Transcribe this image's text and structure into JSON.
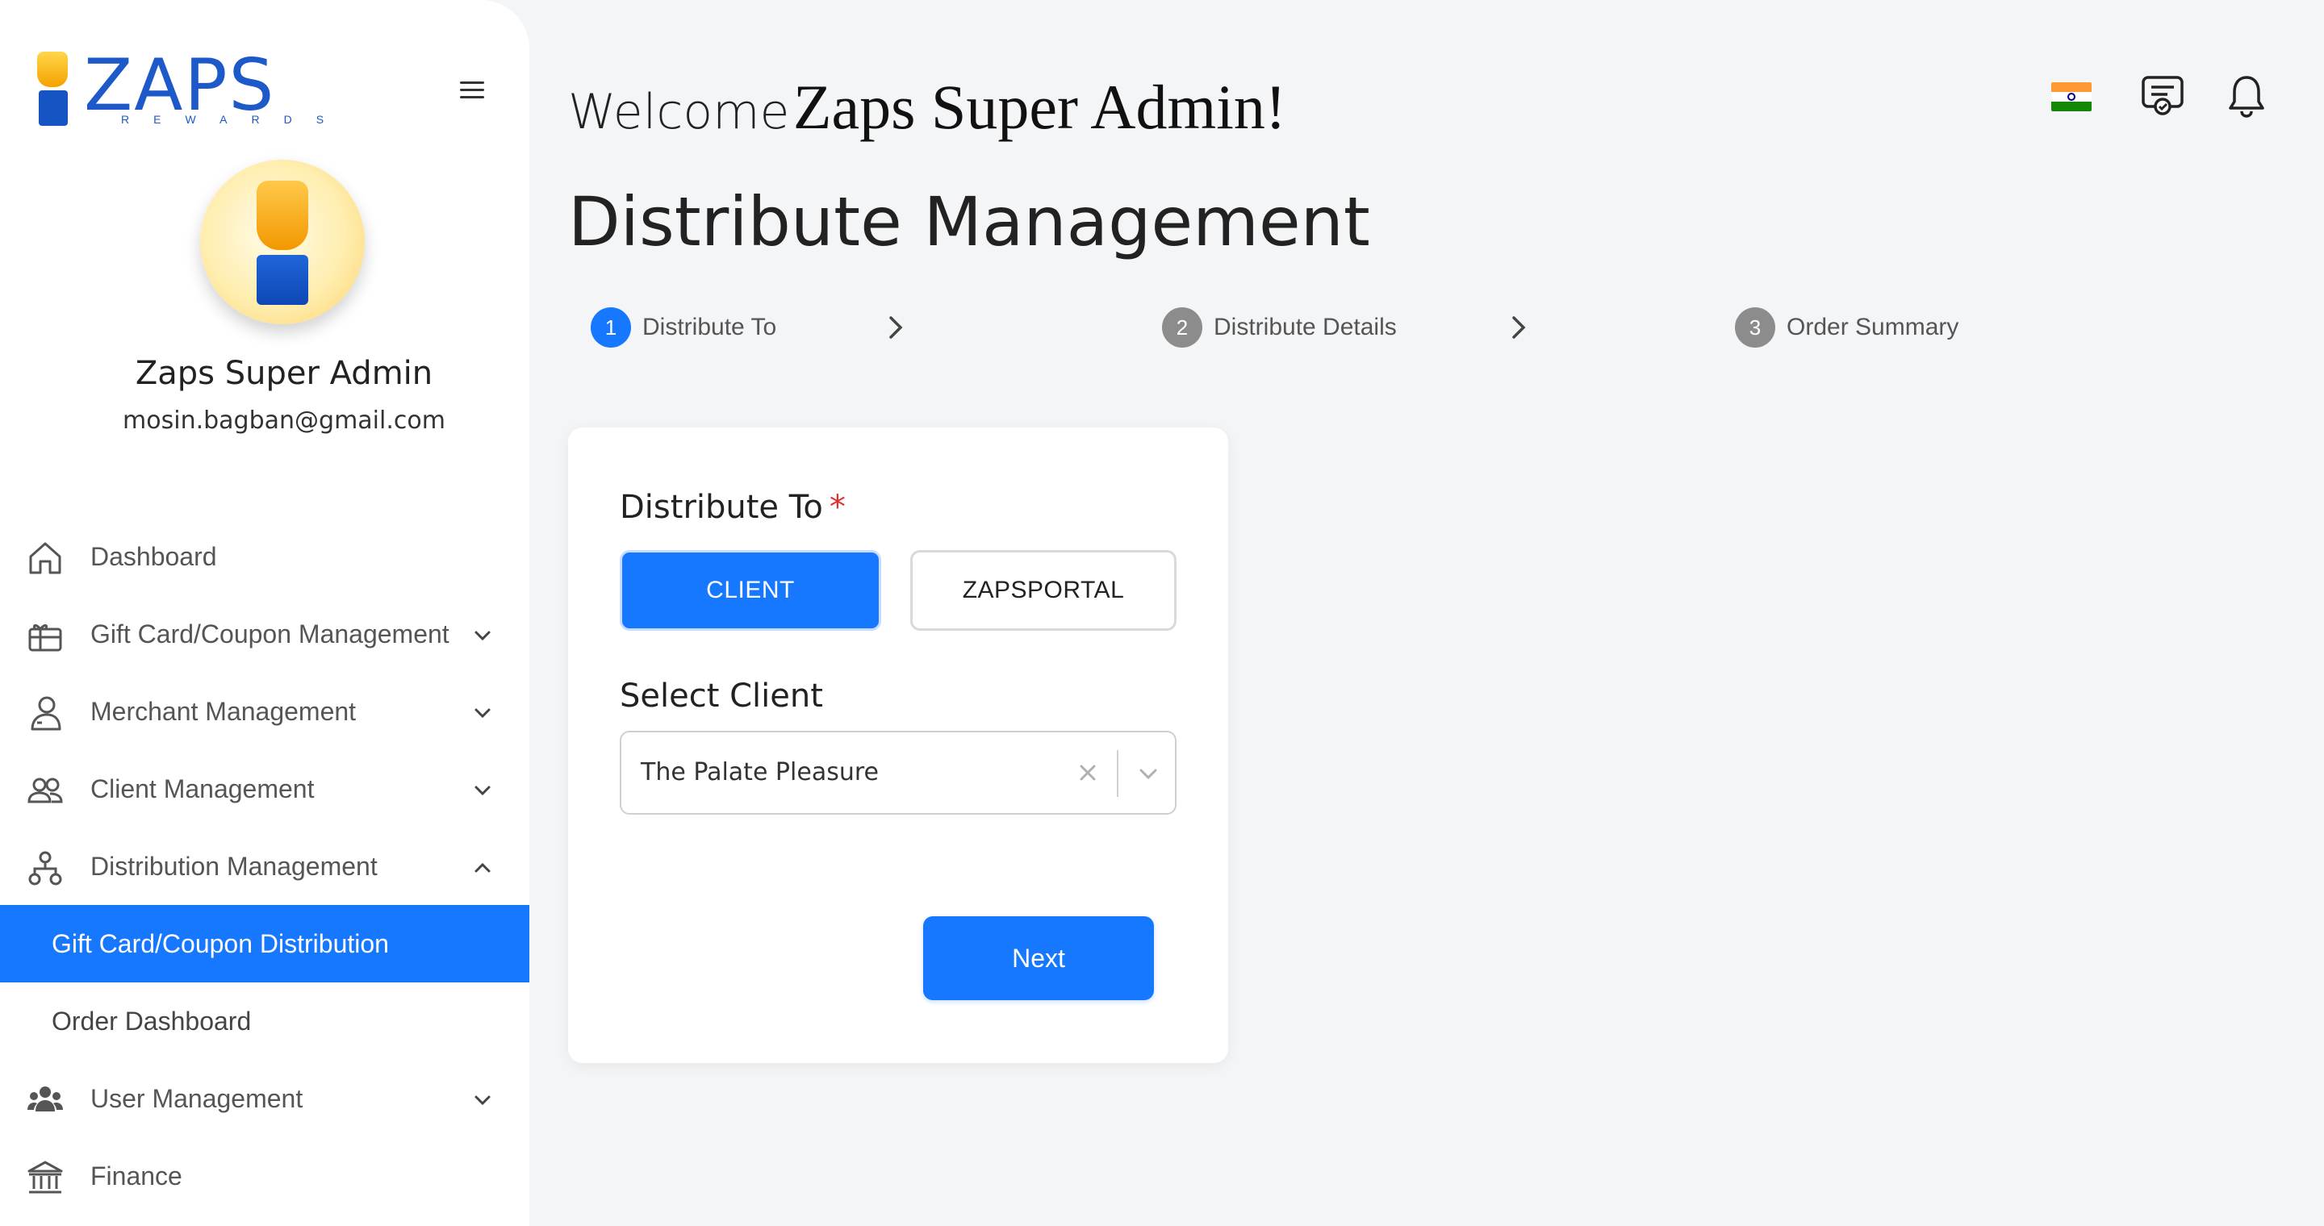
{
  "brand": {
    "name": "ZAPS",
    "tagline": "REWARDS"
  },
  "profile": {
    "name": "Zaps Super Admin",
    "email": "mosin.bagban@gmail.com"
  },
  "sidebar": {
    "items": [
      {
        "label": "Dashboard",
        "icon": "home-icon"
      },
      {
        "label": "Gift Card/Coupon Management",
        "icon": "gift-icon"
      },
      {
        "label": "Merchant Management",
        "icon": "merchant-icon"
      },
      {
        "label": "Client Management",
        "icon": "users-icon"
      },
      {
        "label": "Distribution Management",
        "icon": "network-icon"
      },
      {
        "label": "User Management",
        "icon": "group-icon"
      },
      {
        "label": "Finance",
        "icon": "bank-icon"
      }
    ],
    "subitems": [
      {
        "label": "Gift Card/Coupon Distribution",
        "active": true
      },
      {
        "label": "Order Dashboard",
        "active": false
      }
    ]
  },
  "header": {
    "welcome_prefix": "Welcome",
    "welcome_name": "Zaps Super Admin!",
    "page_title": "Distribute Management"
  },
  "steps": [
    {
      "number": "1",
      "label": "Distribute To",
      "status": "active"
    },
    {
      "number": "2",
      "label": "Distribute Details",
      "status": "pending"
    },
    {
      "number": "3",
      "label": "Order Summary",
      "status": "pending"
    }
  ],
  "form": {
    "distribute_to_label": "Distribute To",
    "required_mark": "*",
    "option_client": "CLIENT",
    "option_zapsportal": "ZAPSPORTAL",
    "selected_option": "CLIENT",
    "select_client_label": "Select Client",
    "select_client_value": "The Palate Pleasure",
    "next_label": "Next"
  },
  "colors": {
    "primary": "#1677ff",
    "step_inactive": "#8c8c8c",
    "brand_blue": "#1d59c9",
    "brand_orange": "#f5a200",
    "required": "#e03131"
  }
}
